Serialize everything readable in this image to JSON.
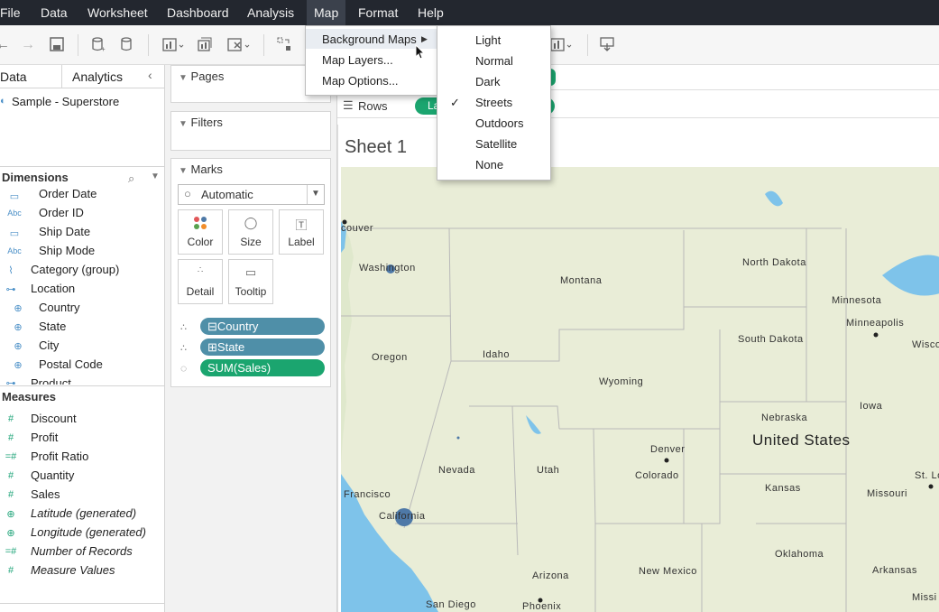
{
  "menubar": {
    "items": [
      "File",
      "Data",
      "Worksheet",
      "Dashboard",
      "Analysis",
      "Map",
      "Format",
      "Help"
    ]
  },
  "map_menu": {
    "items": [
      "Background Maps",
      "Map Layers...",
      "Map Options..."
    ]
  },
  "background_maps": {
    "items": [
      "Light",
      "Normal",
      "Dark",
      "Streets",
      "Outdoors",
      "Satellite",
      "None"
    ],
    "selected": "Streets"
  },
  "data_pane": {
    "tabs": [
      "Data",
      "Analytics"
    ],
    "source": "Sample - Superstore",
    "dimensions_header": "Dimensions",
    "dimensions": [
      {
        "icon": "calendar-icon",
        "label": "Order Date"
      },
      {
        "icon": "abc-icon",
        "label": "Order ID"
      },
      {
        "icon": "calendar-icon",
        "label": "Ship Date"
      },
      {
        "icon": "abc-icon",
        "label": "Ship Mode"
      },
      {
        "icon": "paperclip-icon",
        "label": "Category (group)"
      },
      {
        "icon": "hierarchy-icon",
        "label": "Location"
      },
      {
        "icon": "globe-icon",
        "label": "Country"
      },
      {
        "icon": "globe-icon",
        "label": "State"
      },
      {
        "icon": "globe-icon",
        "label": "City"
      },
      {
        "icon": "globe-icon",
        "label": "Postal Code"
      },
      {
        "icon": "hierarchy-icon",
        "label": "Product"
      }
    ],
    "measures_header": "Measures",
    "measures": [
      {
        "icon": "number-icon",
        "label": "Discount",
        "italic": false
      },
      {
        "icon": "number-icon",
        "label": "Profit",
        "italic": false
      },
      {
        "icon": "number-icon",
        "label": "Profit Ratio",
        "italic": false
      },
      {
        "icon": "number-icon",
        "label": "Quantity",
        "italic": false
      },
      {
        "icon": "number-icon",
        "label": "Sales",
        "italic": false
      },
      {
        "icon": "globe-icon",
        "label": "Latitude (generated)",
        "italic": true
      },
      {
        "icon": "globe-icon",
        "label": "Longitude (generated)",
        "italic": true
      },
      {
        "icon": "number-icon",
        "label": "Number of Records",
        "italic": true
      },
      {
        "icon": "number-icon",
        "label": "Measure Values",
        "italic": true
      }
    ]
  },
  "cards": {
    "pages": "Pages",
    "filters": "Filters",
    "marks": "Marks",
    "mark_type": "Automatic",
    "mark_buttons": [
      "Color",
      "Size",
      "Label",
      "Detail",
      "Tooltip"
    ],
    "pills": [
      {
        "label": "Country",
        "prefix": "⊟",
        "color": "#4f8fa8"
      },
      {
        "label": "State",
        "prefix": "⊞",
        "color": "#4f8fa8"
      },
      {
        "label": "SUM(Sales)",
        "prefix": "",
        "color": "#1ba56f"
      }
    ]
  },
  "shelves": {
    "rows_label": "Rows"
  },
  "view": {
    "sheet_title": "Sheet 1"
  },
  "map_labels": {
    "vancouver": "couver",
    "washington": "Washington",
    "oregon": "Oregon",
    "idaho": "Idaho",
    "montana": "Montana",
    "wyoming": "Wyoming",
    "nevada": "Nevada",
    "utah": "Utah",
    "california": "California",
    "san_francisco": "Francisco",
    "colorado": "Colorado",
    "denver": "Denver",
    "north_dakota": "North Dakota",
    "south_dakota": "South Dakota",
    "nebraska": "Nebraska",
    "kansas": "Kansas",
    "minnesota": "Minnesota",
    "minneapolis": "Minneapolis",
    "iowa": "Iowa",
    "missouri": "Missouri",
    "oklahoma": "Oklahoma",
    "arkansas": "Arkansas",
    "arizona": "Arizona",
    "new_mexico": "New Mexico",
    "phoenix": "Phoenix",
    "san_diego": "San Diego",
    "united_states": "United States",
    "wisconsin": "Wisco",
    "st_louis": "St. Lou",
    "mississippi": "Missi"
  }
}
